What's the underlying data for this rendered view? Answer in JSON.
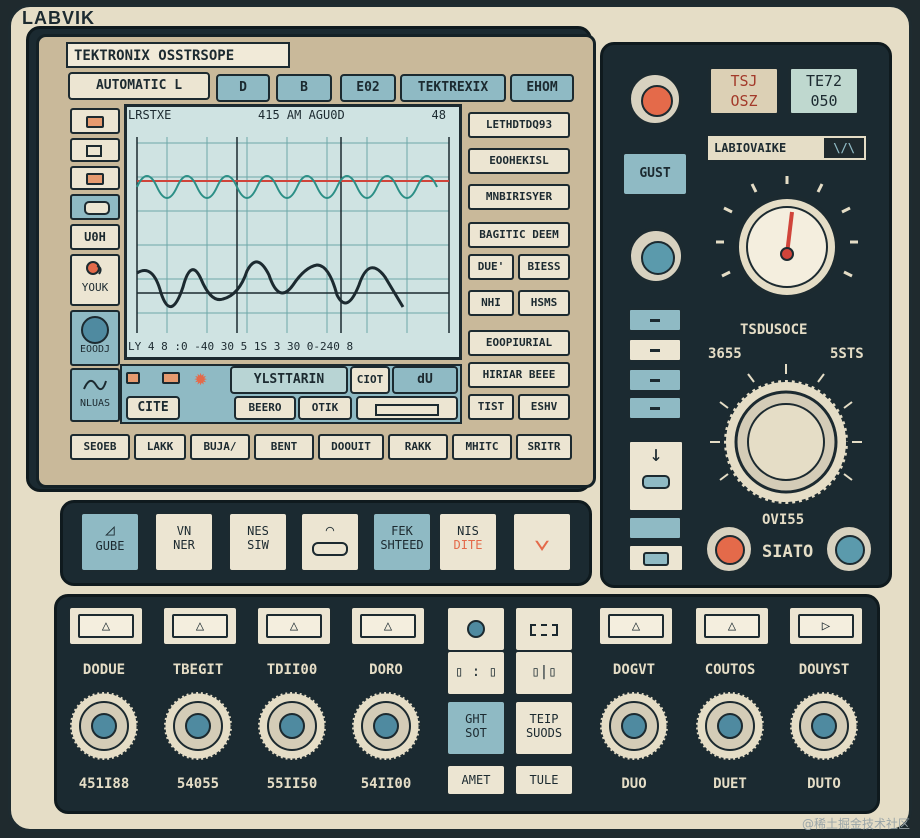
{
  "brand": "LABVIK",
  "device_title": "TEKTRONIX OSSTRSOPE",
  "top_buttons": [
    "AUTOMATIC L",
    "D",
    "B",
    "E02",
    "TEKTREXIX",
    "EHOM"
  ],
  "scope": {
    "header_left": "LRSTXE",
    "header_mid": "415  AM AGU0D",
    "header_right": "48",
    "footer": "LY 4 8 :0 -40 30   5  1S  3 30 0-240 8"
  },
  "left_panel": {
    "labels": [
      "U0H",
      "YOUK",
      "EOODJ",
      "NLUAS"
    ],
    "bottom_left": "CITE"
  },
  "scope_lower": {
    "main_label": "YLSTTARIN",
    "sub_label": "CIOT",
    "sub2": "dU",
    "bar_btn1": "BEERO",
    "bar_btn2": "OTIK"
  },
  "right_side_buttons": [
    "LETHDTDQ93",
    "EOOHEKISL",
    "MNBIRISYER",
    "BAGITIC DEEM",
    "DUE'",
    "BIESS",
    "NHI",
    "HSMS",
    "EOOPIURIAL",
    "HIRIAR BEEE",
    "TIST",
    "ESHV"
  ],
  "bottom_row": [
    "SEOEB",
    "LAKK",
    "BUJA/",
    "BENT",
    "DOOUIT",
    "RAKK",
    "MHITC",
    "SRITR"
  ],
  "mid_buttons": [
    {
      "top": "",
      "bottom": "GUBE",
      "blue": true
    },
    {
      "top": "VN",
      "bottom": "NER",
      "blue": false
    },
    {
      "top": "NES",
      "bottom": "SIW",
      "blue": false
    },
    {
      "top": "",
      "bottom": "",
      "blue": false
    },
    {
      "top": "FEK",
      "bottom": "SHTEED",
      "blue": true
    },
    {
      "top": "NIS",
      "bottom": "DITE",
      "blue": false
    },
    {
      "top": "",
      "bottom": "",
      "blue": false
    }
  ],
  "right_panel": {
    "lcd1_line1": "TSJ",
    "lcd1_line2": "OSZ",
    "lcd2_line1": "TE72",
    "lcd2_line2": "050",
    "logo_text": "LABIOVAIKE",
    "gust_label": "GUST",
    "dial_label": "TSDUSOCE",
    "dial_left": "3655",
    "dial_right": "5STS",
    "knob_label": "OVI55",
    "siato_label": "SIATO"
  },
  "channels": [
    {
      "label": "DODUE",
      "value": "451I88"
    },
    {
      "label": "TBEGIT",
      "value": "54055"
    },
    {
      "label": "TDII00",
      "value": "55II50"
    },
    {
      "label": "DORO",
      "value": "54II00"
    },
    {
      "label": "DOGVT",
      "value": "DUO"
    },
    {
      "label": "COUTOS",
      "value": "DUET"
    },
    {
      "label": "DOUYST",
      "value": "DUTO"
    }
  ],
  "center_stack": {
    "ght": "GHT",
    "sot": "SOT",
    "teip": "TEIP",
    "suods": "SUODS",
    "amet": "AMET",
    "tule": "TULE"
  },
  "watermark": "@稀土掘金技术社区",
  "colors": {
    "accent_blue": "#8fbac4",
    "accent_orange": "#e46a4a",
    "panel": "#1b2a31",
    "cream": "#e5ddc6"
  }
}
